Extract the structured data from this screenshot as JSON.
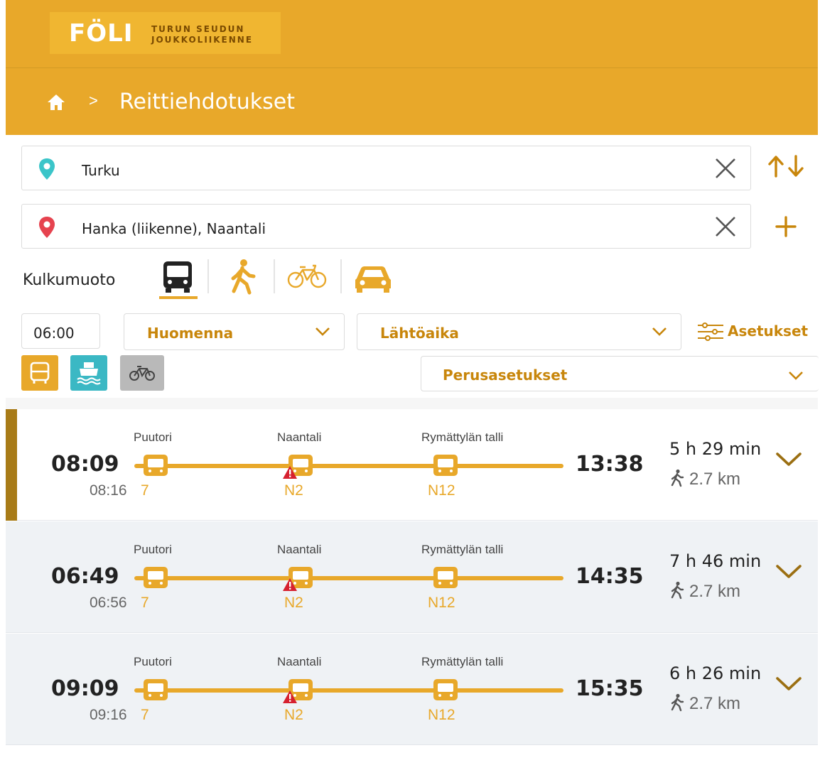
{
  "header": {
    "logo_brand": "FÖLI",
    "logo_line1": "TURUN SEUDUN",
    "logo_line2": "JOUKKOLIIKENNE",
    "breadcrumb_separator": ">",
    "page_title": "Reittiehdotukset"
  },
  "search": {
    "from_value": "Turku",
    "to_value": "Hanka (liikenne), Naantali"
  },
  "mode": {
    "label": "Kulkumuoto",
    "options": [
      "bus-icon",
      "walk-icon",
      "bicycle-icon",
      "car-icon"
    ],
    "selected": "bus-icon"
  },
  "time": {
    "value": "06:00",
    "day": "Huomenna",
    "type": "Lähtöaika",
    "settings_label": "Asetukset",
    "preset": "Perusasetukset"
  },
  "filters": [
    "bus-icon",
    "ferry-icon",
    "citybike-icon"
  ],
  "colors": {
    "brand": "#e8a82a",
    "accent_text": "#c8860b",
    "ferry": "#3bb8c4",
    "alert": "#d6202f"
  },
  "results": [
    {
      "departure": "08:09",
      "first_stop_time": "08:16",
      "first_line": "7",
      "stops": [
        "Puutori",
        "Naantali",
        "Rymättylän talli"
      ],
      "lines": [
        "N2",
        "N12"
      ],
      "arrival": "13:38",
      "duration": "5 h 29 min",
      "walk": "2.7 km",
      "selected": true
    },
    {
      "departure": "06:49",
      "first_stop_time": "06:56",
      "first_line": "7",
      "stops": [
        "Puutori",
        "Naantali",
        "Rymättylän talli"
      ],
      "lines": [
        "N2",
        "N12"
      ],
      "arrival": "14:35",
      "duration": "7 h 46 min",
      "walk": "2.7 km",
      "selected": false
    },
    {
      "departure": "09:09",
      "first_stop_time": "09:16",
      "first_line": "7",
      "stops": [
        "Puutori",
        "Naantali",
        "Rymättylän talli"
      ],
      "lines": [
        "N2",
        "N12"
      ],
      "arrival": "15:35",
      "duration": "6 h 26 min",
      "walk": "2.7 km",
      "selected": false
    }
  ]
}
